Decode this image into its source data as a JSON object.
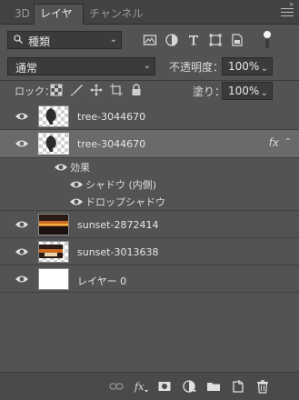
{
  "tabs": [
    {
      "label": "3D"
    },
    {
      "label": "レイヤー"
    },
    {
      "label": "チャンネル"
    }
  ],
  "filter": {
    "label": "種類"
  },
  "filter_icons": [
    "image-filter-icon",
    "adjustment-filter-icon",
    "type-filter-icon",
    "shape-filter-icon",
    "smart-object-filter-icon"
  ],
  "blend": {
    "mode": "通常",
    "opacity_label": "不透明度：",
    "opacity": "100%",
    "lock_label": "ロック：",
    "fill_label": "塗り：",
    "fill": "100%"
  },
  "lock_icons": [
    "lock-transparent-icon",
    "lock-image-icon",
    "lock-position-icon",
    "lock-artboard-icon",
    "lock-all-icon"
  ],
  "layers": [
    {
      "name": "tree-3044670",
      "thumb": "checker",
      "selected": false
    },
    {
      "name": "tree-3044670",
      "thumb": "checker",
      "selected": true,
      "fx": "fx"
    },
    {
      "name": "sunset-2872414",
      "thumb": "sunset",
      "selected": false
    },
    {
      "name": "sunset-3013638",
      "thumb": "sunset",
      "selected": false
    },
    {
      "name": "レイヤー 0",
      "thumb": "white",
      "selected": false
    }
  ],
  "effects": {
    "header": "効果",
    "items": [
      "シャドウ (内側)",
      "ドロップシャドウ"
    ]
  },
  "bottom_icons": [
    "link-layers-icon",
    "fx-icon",
    "add-mask-icon",
    "adjustment-layer-icon",
    "new-group-icon",
    "new-layer-icon",
    "delete-layer-icon"
  ],
  "colors": {
    "panel": "#535353",
    "tabbar": "#424242",
    "selected_row": "#6a6a6a"
  }
}
